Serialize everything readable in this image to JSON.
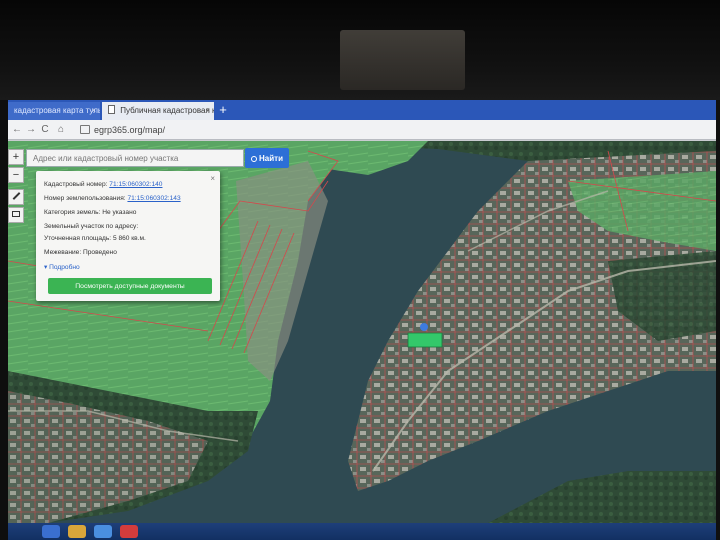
{
  "browser": {
    "tabs": [
      {
        "label": "кадастровая карта тульс…",
        "close": "×"
      },
      {
        "label": "Публичная кадастровая к…",
        "close": "×"
      }
    ],
    "new_tab": "+",
    "back": "←",
    "forward": "→",
    "reload": "C",
    "home": "⌂",
    "url": "egrp365.org/map/"
  },
  "search": {
    "placeholder": "Адрес или кадастровый номер участка",
    "button_label": "Найти"
  },
  "tools": {
    "zoom_in": "+",
    "zoom_out": "−"
  },
  "info_card": {
    "close": "×",
    "cadastral_label": "Кадастровый номер:",
    "cadastral_value": "71:15:060302:140",
    "land_use_label": "Номер землепользования:",
    "land_use_value": "71:15:060302:143",
    "category_label": "Категория земель:",
    "category_value": "Не указано",
    "address_label": "Земельный участок по адресу:",
    "area_label": "Уточненная площадь:",
    "area_value": "5 860 кв.м.",
    "survey_label": "Межевание:",
    "survey_value": "Проведено",
    "more_label": "Подробно",
    "docs_button": "Посмотреть доступные документы"
  },
  "map": {
    "colors": {
      "water": "#2f4a52",
      "field": "#58a060",
      "forest": "#2f4b36",
      "village": "#58665a",
      "plot_line": "#d4484c",
      "selected_plot": "#33c86a"
    }
  }
}
